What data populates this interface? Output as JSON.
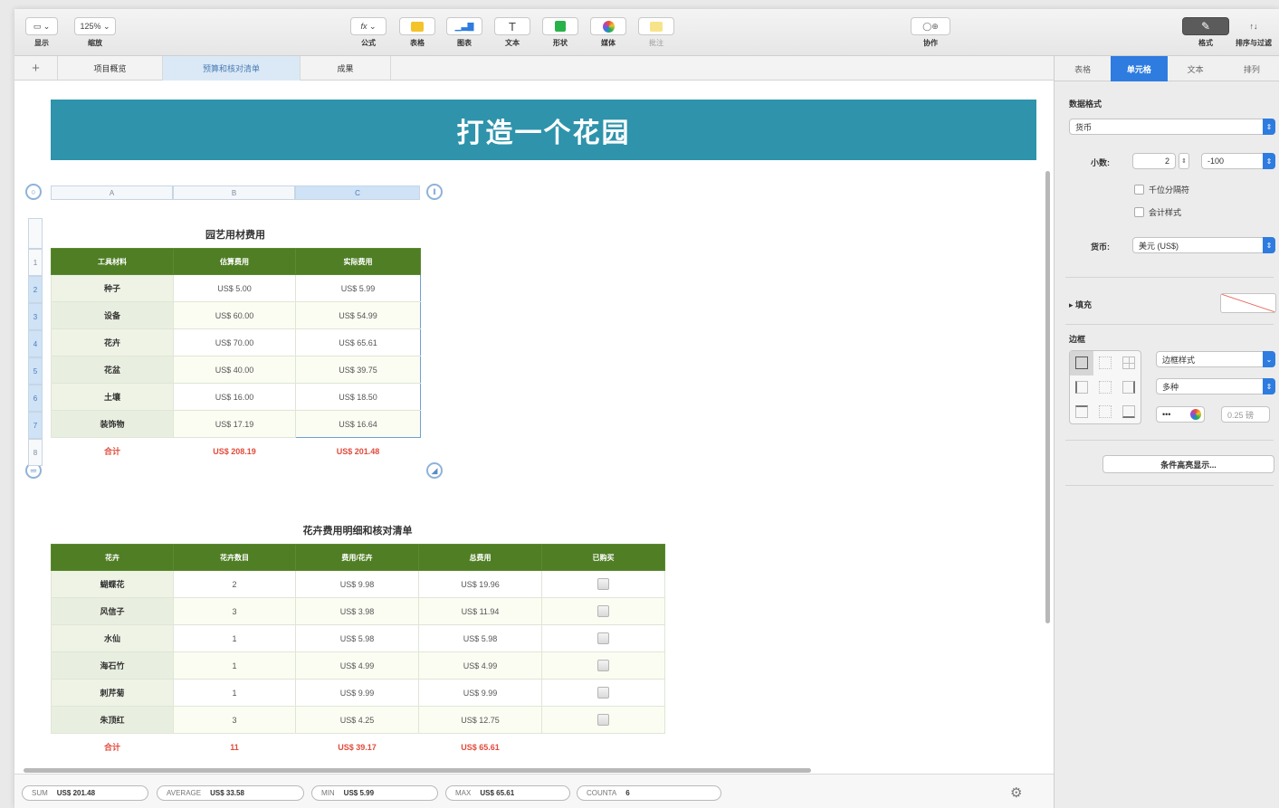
{
  "toolbar": {
    "view_label": "显示",
    "zoom_value": "125%",
    "zoom_label": "缩放",
    "formula_glyph": "fx",
    "formula_label": "公式",
    "table_label": "表格",
    "chart_label": "图表",
    "text_glyph": "T",
    "text_label": "文本",
    "shape_label": "形状",
    "media_label": "媒体",
    "comment_label": "批注",
    "collab_label": "协作",
    "format_label": "格式",
    "sort_glyph": "↑↓",
    "sort_label": "排序与过滤"
  },
  "tabs": {
    "add_glyph": "+",
    "items": [
      "项目概览",
      "预算和核对清单",
      "成果"
    ],
    "active_index": 1
  },
  "banner": {
    "title": "打造一个花园"
  },
  "colors": {
    "header_green": "#4f7e24",
    "banner_teal": "#2e93ab",
    "total_red": "#e24a3b",
    "accent_blue": "#2e7ce0"
  },
  "table1": {
    "title": "园艺用材费用",
    "column_letters": [
      "A",
      "B",
      "C"
    ],
    "row_numbers": [
      "1",
      "2",
      "3",
      "4",
      "5",
      "6",
      "7",
      "8"
    ],
    "headers": [
      "工具材料",
      "估算费用",
      "实际费用"
    ],
    "rows": [
      [
        "种子",
        "US$ 5.00",
        "US$ 5.99"
      ],
      [
        "设备",
        "US$ 60.00",
        "US$ 54.99"
      ],
      [
        "花卉",
        "US$ 70.00",
        "US$ 65.61"
      ],
      [
        "花盆",
        "US$ 40.00",
        "US$ 39.75"
      ],
      [
        "土壤",
        "US$ 16.00",
        "US$ 18.50"
      ],
      [
        "装饰物",
        "US$ 17.19",
        "US$ 16.64"
      ]
    ],
    "total": [
      "合计",
      "US$ 208.19",
      "US$ 201.48"
    ]
  },
  "table2": {
    "title": "花卉费用明细和核对清单",
    "headers": [
      "花卉",
      "花卉数目",
      "费用/花卉",
      "总费用",
      "已购买"
    ],
    "rows": [
      [
        "蝴蝶花",
        "2",
        "US$ 9.98",
        "US$ 19.96"
      ],
      [
        "风信子",
        "3",
        "US$ 3.98",
        "US$ 11.94"
      ],
      [
        "水仙",
        "1",
        "US$ 5.98",
        "US$ 5.98"
      ],
      [
        "海石竹",
        "1",
        "US$ 4.99",
        "US$ 4.99"
      ],
      [
        "刺芹菊",
        "1",
        "US$ 9.99",
        "US$ 9.99"
      ],
      [
        "朱顶红",
        "3",
        "US$ 4.25",
        "US$ 12.75"
      ]
    ],
    "total": [
      "合计",
      "11",
      "US$ 39.17",
      "US$ 65.61"
    ]
  },
  "statusbar": {
    "sum_label": "SUM",
    "sum_value": "US$ 201.48",
    "avg_label": "AVERAGE",
    "avg_value": "US$ 33.58",
    "min_label": "MIN",
    "min_value": "US$ 5.99",
    "max_label": "MAX",
    "max_value": "US$ 65.61",
    "counta_label": "COUNTA",
    "counta_value": "6",
    "gear_glyph": "⚙"
  },
  "inspector": {
    "tabs": [
      "表格",
      "单元格",
      "文本",
      "排列"
    ],
    "active_tab": 1,
    "data_format_label": "数据格式",
    "data_format_value": "货币",
    "decimals_label": "小数:",
    "decimals_value": "2",
    "negative_value": "-100",
    "thousands_label": "千位分隔符",
    "accounting_label": "会计样式",
    "currency_label": "货币:",
    "currency_value": "美元 (US$)",
    "fill_label": "填充",
    "border_label": "边框",
    "border_style_value": "边框样式",
    "border_type_value": "多种",
    "border_dots": "•••",
    "border_width_value": "0.25 磅",
    "conditional_label": "条件高亮显示..."
  }
}
